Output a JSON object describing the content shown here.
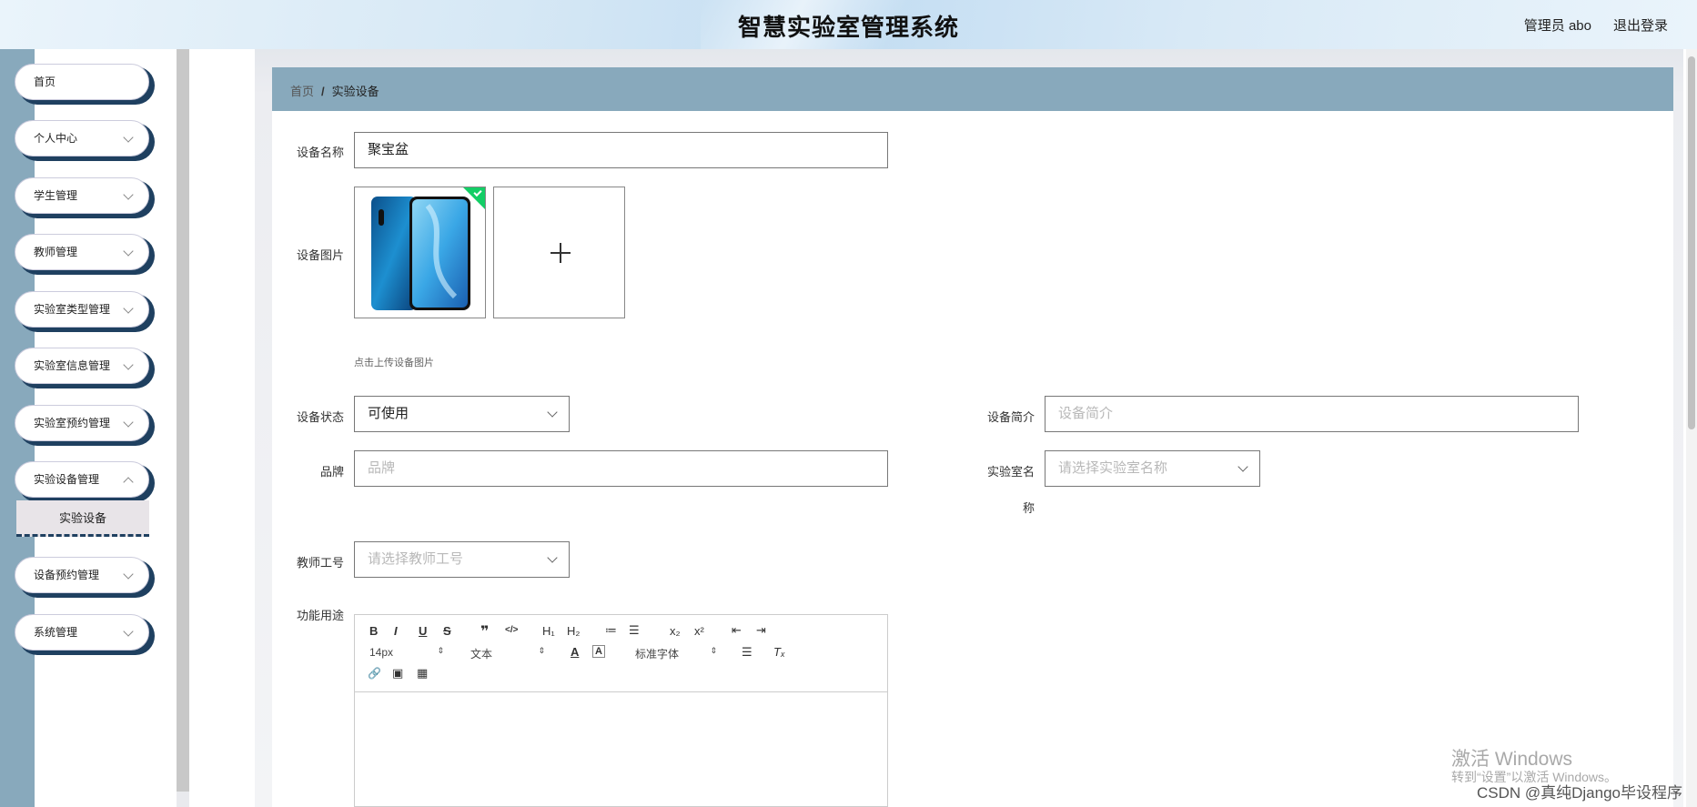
{
  "header": {
    "title": "智慧实验室管理系统",
    "user": "管理员 abo",
    "logout": "退出登录"
  },
  "sidebar": {
    "items": [
      {
        "label": "首页",
        "has_arrow": false
      },
      {
        "label": "个人中心",
        "has_arrow": true
      },
      {
        "label": "学生管理",
        "has_arrow": true
      },
      {
        "label": "教师管理",
        "has_arrow": true
      },
      {
        "label": "实验室类型管理",
        "has_arrow": true
      },
      {
        "label": "实验室信息管理",
        "has_arrow": true
      },
      {
        "label": "实验室预约管理",
        "has_arrow": true
      },
      {
        "label": "实验设备管理",
        "has_arrow": true
      },
      {
        "label": "设备预约管理",
        "has_arrow": true
      },
      {
        "label": "系统管理",
        "has_arrow": true
      }
    ],
    "submenu": {
      "label": "实验设备"
    }
  },
  "breadcrumb": {
    "home": "首页",
    "separator": "/",
    "current": "实验设备"
  },
  "form": {
    "name": {
      "label": "设备名称",
      "value": "聚宝盆"
    },
    "image": {
      "label": "设备图片",
      "hint": "点击上传设备图片",
      "uploaded_count": 1
    },
    "status": {
      "label": "设备状态",
      "value": "可使用"
    },
    "intro": {
      "label": "设备简介",
      "placeholder": "设备简介"
    },
    "brand": {
      "label": "品牌",
      "placeholder": "品牌"
    },
    "lab": {
      "label_line1": "实验室名",
      "label_line2": "称",
      "placeholder": "请选择实验室名称"
    },
    "teacher": {
      "label": "教师工号",
      "placeholder": "请选择教师工号"
    },
    "function": {
      "label": "功能用途"
    }
  },
  "editor": {
    "font_size": "14px",
    "text_type": "文本",
    "font_family": "标准字体",
    "buttons": {
      "bold": "B",
      "italic": "I",
      "underline": "U",
      "strike": "S",
      "quote": "❞",
      "code": "</>",
      "h1": "H₁",
      "h2": "H₂",
      "ol": "≔",
      "ul": "☰",
      "sub": "x₂",
      "sup": "x²",
      "outdent": "⇤",
      "indent": "⇥",
      "color": "A",
      "bg": "A",
      "align": "☰",
      "clear": "Tₓ",
      "link": "🔗",
      "image": "▣",
      "video": "▦"
    }
  },
  "watermark": {
    "line1": "激活 Windows",
    "line2": "转到“设置”以激活 Windows。",
    "csdn": "CSDN @真纯Django毕设程序"
  }
}
